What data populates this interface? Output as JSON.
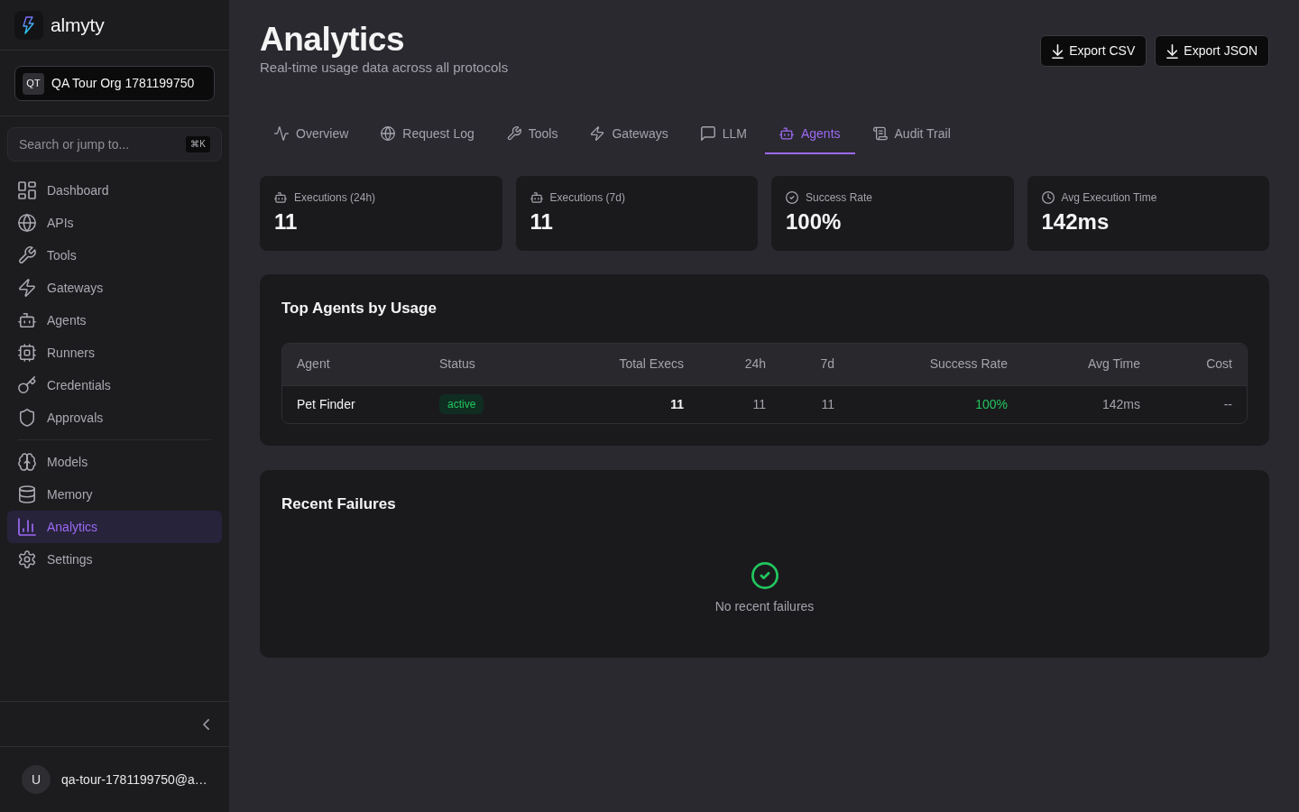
{
  "brand": {
    "name": "almyty"
  },
  "org": {
    "initials": "QT",
    "name": "QA Tour Org 1781199750"
  },
  "search": {
    "placeholder": "Search or jump to...",
    "shortcut": "⌘K"
  },
  "nav_groups": [
    {
      "items": [
        {
          "label": "Dashboard",
          "selected": false
        },
        {
          "label": "APIs",
          "selected": false
        },
        {
          "label": "Tools",
          "selected": false
        },
        {
          "label": "Gateways",
          "selected": false
        },
        {
          "label": "Agents",
          "selected": false
        },
        {
          "label": "Runners",
          "selected": false
        },
        {
          "label": "Credentials",
          "selected": false
        },
        {
          "label": "Approvals",
          "selected": false
        }
      ]
    },
    {
      "items": [
        {
          "label": "Models",
          "selected": false
        },
        {
          "label": "Memory",
          "selected": false
        },
        {
          "label": "Analytics",
          "selected": true
        },
        {
          "label": "Settings",
          "selected": false
        }
      ]
    }
  ],
  "user": {
    "initial": "U",
    "email": "qa-tour-1781199750@a…"
  },
  "page": {
    "title": "Analytics",
    "subtitle": "Real-time usage data across all protocols"
  },
  "actions": [
    {
      "label": "Export CSV"
    },
    {
      "label": "Export JSON"
    }
  ],
  "tabs": [
    {
      "label": "Overview",
      "selected": false
    },
    {
      "label": "Request Log",
      "selected": false
    },
    {
      "label": "Tools",
      "selected": false
    },
    {
      "label": "Gateways",
      "selected": false
    },
    {
      "label": "LLM",
      "selected": false
    },
    {
      "label": "Agents",
      "selected": true
    },
    {
      "label": "Audit Trail",
      "selected": false
    }
  ],
  "stats": [
    {
      "label": "Executions (24h)",
      "value": "11"
    },
    {
      "label": "Executions (7d)",
      "value": "11"
    },
    {
      "label": "Success Rate",
      "value": "100%"
    },
    {
      "label": "Avg Execution Time",
      "value": "142ms"
    }
  ],
  "top_agents": {
    "title": "Top Agents by Usage",
    "columns": [
      "Agent",
      "Status",
      "Total Execs",
      "24h",
      "7d",
      "Success Rate",
      "Avg Time",
      "Cost"
    ],
    "rows": [
      {
        "cells": [
          "Pet Finder",
          "active",
          "11",
          "11",
          "11",
          "100%",
          "142ms",
          "--"
        ]
      }
    ]
  },
  "recent_failures": {
    "title": "Recent Failures",
    "empty_message": "No recent failures"
  }
}
